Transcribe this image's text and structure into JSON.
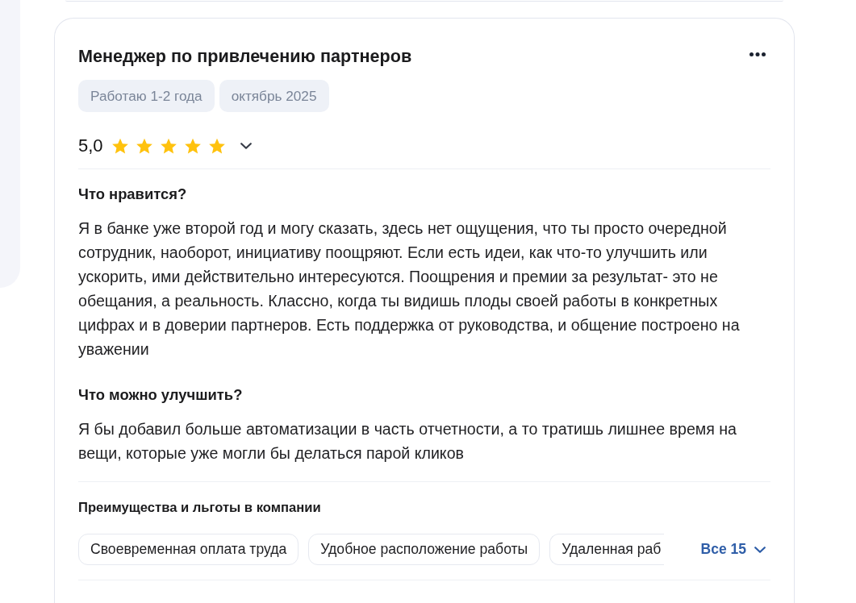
{
  "review": {
    "title": "Менеджер по привлечению партнеров",
    "tags": [
      "Работаю 1-2 года",
      "октябрь 2025"
    ],
    "rating": "5,0",
    "stars": 5,
    "sections": [
      {
        "heading": "Что нравится?",
        "text": "Я в банке уже второй год и могу сказать, здесь нет ощущения, что ты просто очередной сотрудник, наоборот, инициативу поощряют. Если есть идеи, как что-то улучшить или ускорить, ими действительно интересуются. Поощрения и премии за результат- это не обещания, а реальность. Классно, когда ты видишь плоды своей работы в конкретных цифрах и в доверии партнеров. Есть поддержка от руководства, и общение построено на уважении"
      },
      {
        "heading": "Что можно улучшить?",
        "text": "Я бы добавил больше автоматизации в часть отчетности, а то тратишь лишнее время на вещи, которые уже могли бы делаться парой кликов"
      }
    ],
    "benefits": {
      "heading": "Преимущества и льготы в компании",
      "items": [
        "Своевременная оплата труда",
        "Удобное расположение работы",
        "Удаленная раб"
      ],
      "more_link": "Все 15"
    }
  }
}
